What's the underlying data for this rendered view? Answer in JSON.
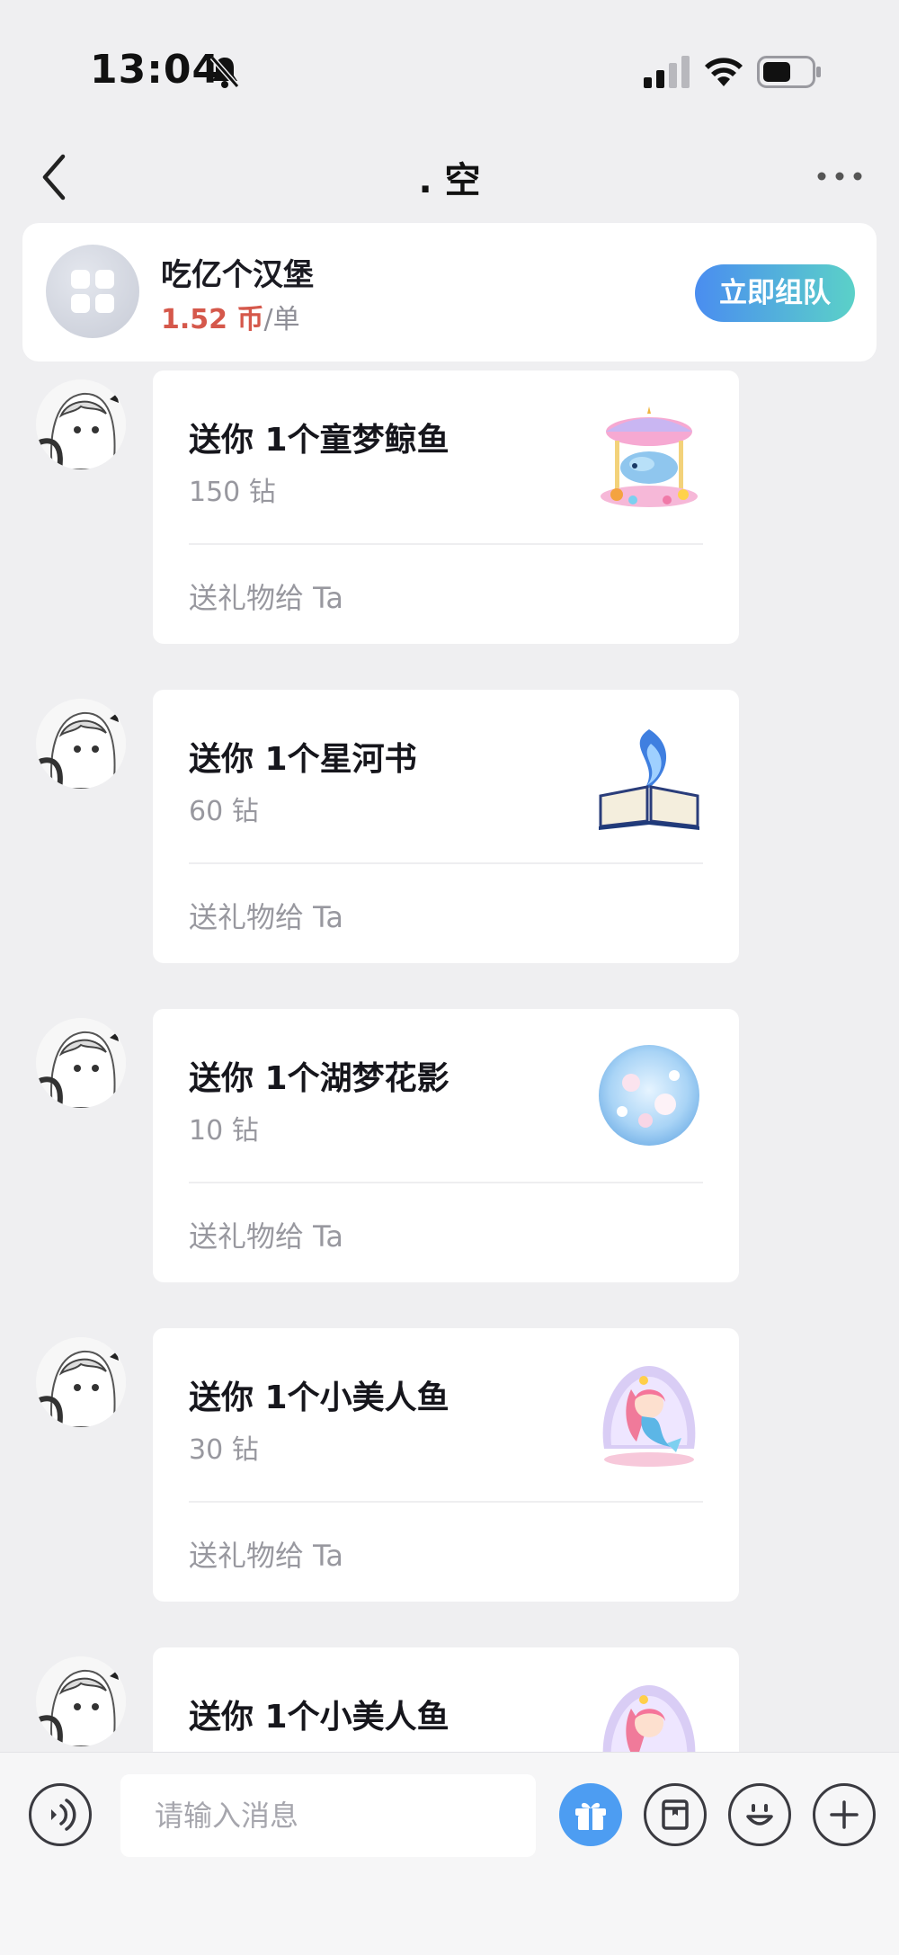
{
  "status_bar": {
    "time": "13:04",
    "icons": [
      "bell-slash-icon",
      "signal-icon",
      "wifi-icon",
      "battery-icon"
    ]
  },
  "nav": {
    "title": ". 空",
    "back_icon": "chevron-left-icon",
    "more_icon": "more-dots-icon"
  },
  "order": {
    "name": "吃亿个汉堡",
    "price": "1.52 币",
    "unit": "/单",
    "action": "立即组队"
  },
  "messages": [
    {
      "title": "送你 1个童梦鲸鱼",
      "price": "150 钻",
      "action": "送礼物给 Ta",
      "gift": "carousel-whale"
    },
    {
      "title": "送你 1个星河书",
      "price": "60 钻",
      "action": "送礼物给 Ta",
      "gift": "galaxy-book"
    },
    {
      "title": "送你 1个湖梦花影",
      "price": "10 钻",
      "action": "送礼物给 Ta",
      "gift": "lake-flower-orb"
    },
    {
      "title": "送你 1个小美人鱼",
      "price": "30 钻",
      "action": "送礼物给 Ta",
      "gift": "little-mermaid"
    },
    {
      "title": "送你 1个小美人鱼",
      "price": "",
      "action": "",
      "gift": "little-mermaid"
    }
  ],
  "input": {
    "placeholder": "请输入消息",
    "buttons": [
      "voice-icon",
      "gift-icon",
      "album-icon",
      "emoji-icon",
      "plus-icon"
    ]
  },
  "colors": {
    "background": "#efeff1",
    "accent_blue": "#4d9df2",
    "price_red": "#d5584b",
    "team_gradient": [
      "#4a8df0",
      "#5bd1c8"
    ]
  }
}
